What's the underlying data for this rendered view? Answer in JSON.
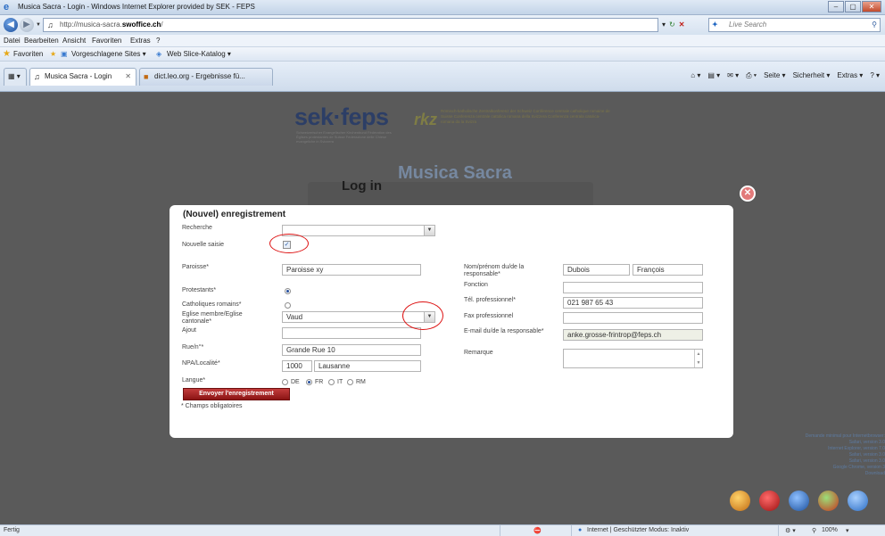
{
  "window": {
    "title": "Musica Sacra - Login - Windows Internet Explorer provided by SEK - FEPS",
    "buttons": [
      "–",
      "▢",
      "✕"
    ]
  },
  "address_bar": {
    "url_prefix": "http://musica-sacra.",
    "url_bold": "swoffice.ch",
    "url_suffix": "/",
    "search_placeholder": "Live Search"
  },
  "menu": {
    "items": [
      "Datei",
      "Bearbeiten",
      "Ansicht",
      "Favoriten",
      "Extras",
      "?"
    ]
  },
  "favorites_bar": {
    "favorites": "Favoriten",
    "suggested": "Vorgeschlagene Sites ▾",
    "webslice": "Web Slice-Katalog ▾"
  },
  "tabs": {
    "active": "Musica Sacra - Login",
    "inactive": "dict.leo.org - Ergebnisse fü..."
  },
  "command_bar": [
    "Seite ▾",
    "Sicherheit ▾",
    "Extras ▾"
  ],
  "page": {
    "brand": "sek·feps",
    "brand_sub": "Schweizerischer Evangelischer Kirchenbund Fédération des Églises protestantes de Suisse Federazione delle Chiese evangeliche in Svizzera",
    "fpe_logo": "rkz",
    "fpe_text": "Römisch-katholische Zentralkonferenz der Schweiz Conférence centrale catholique romaine de Suisse Conferenza centrale cattolica romana della Svizzera Conferenza centrala catolica-romana da la Svizra",
    "musica_title": "Musica Sacra",
    "login_heading": "Log in",
    "notice_title": "Demande minimal pour Internetbrowser:",
    "notice_lines": [
      "Safari, version 3.0",
      "Internet Explorer, version 7.0",
      "Safari, version 3.0",
      "Safari, version 3.0",
      "Google Chrome, version 3",
      "Download"
    ]
  },
  "modal": {
    "title": "(Nouvel) enregistrement",
    "recherche_label": "Recherche",
    "nouvelle_saisie_label": "Nouvelle saisie",
    "paroisse_label": "Paroisse*",
    "paroisse_value": "Paroisse xy",
    "protestants_label": "Protestants*",
    "catholiques_label": "Catholiques romains*",
    "eglise_label": "Eglise membre/Eglise cantonale*",
    "eglise_value": "Vaud",
    "ajout_label": "Ajout",
    "rue_label": "Rue/n°*",
    "rue_value": "Grande Rue 10",
    "npa_label": "NPA/Localité*",
    "npa_value": "1000",
    "localite_value": "Lausanne",
    "langue_label": "Langue*",
    "langue_options": [
      "DE",
      "FR",
      "IT",
      "RM"
    ],
    "langue_selected": "FR",
    "nom_label": "Nom/prénom du/de la responsable*",
    "nom_value": "Dubois",
    "prenom_value": "François",
    "fonction_label": "Fonction",
    "tel_label": "Tél. professionnel*",
    "tel_value": "021 987 65 43",
    "fax_label": "Fax professionnel",
    "email_label": "E-mail du/de la responsable*",
    "email_value": "anke.grosse-frintrop@feps.ch",
    "remarque_label": "Remarque",
    "submit_label": "Envoyer l'enregistrement",
    "mandatory_note": "* Champs obligatoires"
  },
  "status_bar": {
    "left": "Fertig",
    "zone": "Internet | Geschützter Modus: Inaktiv",
    "zoom": "100%"
  },
  "colors": {
    "accent_red": "#c33c3c",
    "annotation_ring": "#dd1111",
    "overlay": "#5a5a5a"
  }
}
